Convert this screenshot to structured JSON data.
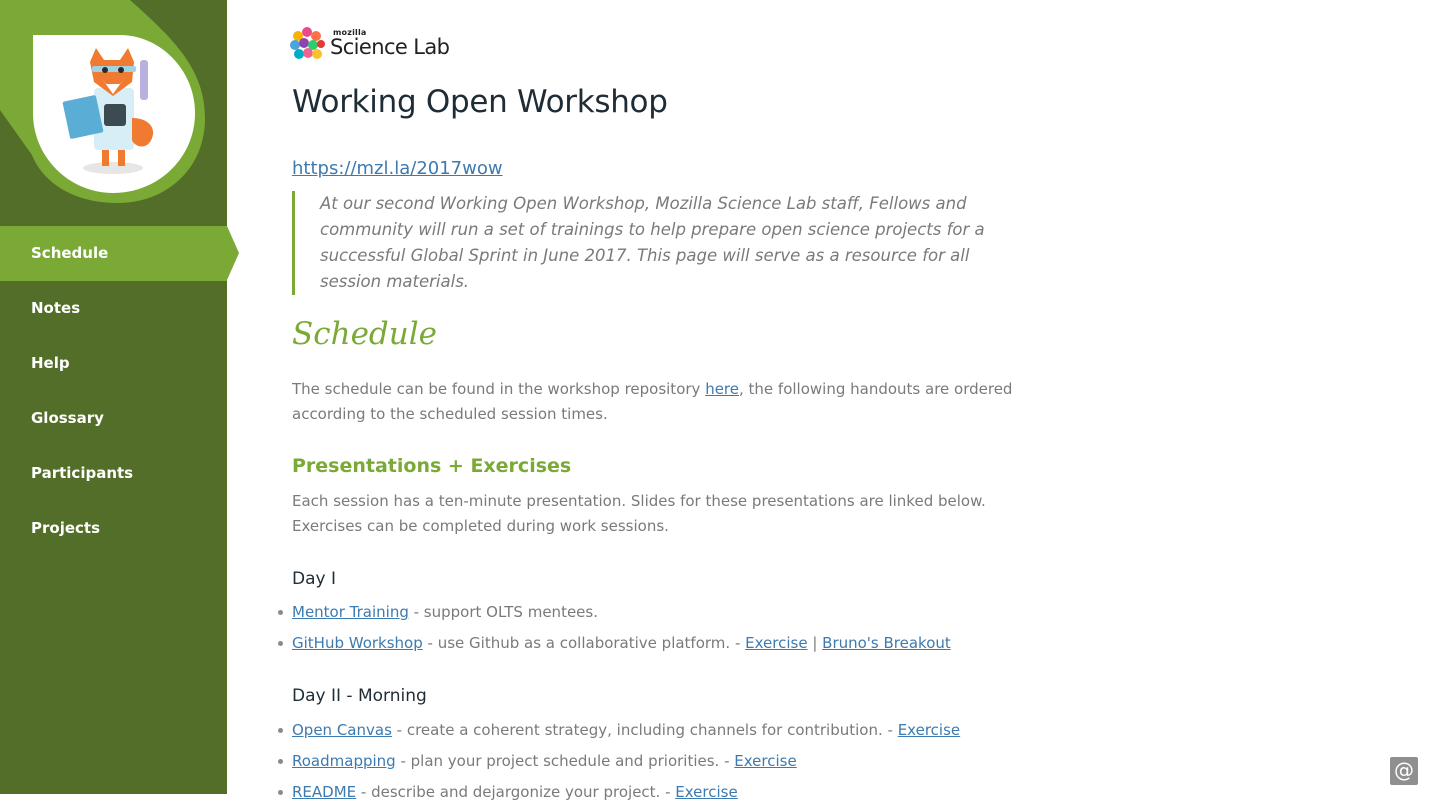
{
  "colors": {
    "sidebar": "#526e28",
    "accent": "#7aaa35",
    "link": "#3d7ab0",
    "heading": "#1f2c36",
    "body_text": "#7a7a7a"
  },
  "logo": {
    "small": "mozilla",
    "big": "Science Lab"
  },
  "nav": {
    "items": [
      {
        "label": "Schedule",
        "active": true
      },
      {
        "label": "Notes"
      },
      {
        "label": "Help"
      },
      {
        "label": "Glossary"
      },
      {
        "label": "Participants"
      },
      {
        "label": "Projects"
      }
    ]
  },
  "page": {
    "title": "Working Open Workshop",
    "short_link": "https://mzl.la/2017wow",
    "intro": "At our second Working Open Workshop, Mozilla Science Lab staff, Fellows and community will run a set of trainings to help prepare open science projects for a successful Global Sprint in June 2017. This page will serve as a resource for all session materials."
  },
  "schedule": {
    "title": "Schedule",
    "text_before": "The schedule can be found in the workshop repository ",
    "link": "here",
    "text_after": ", the following handouts are ordered according to the scheduled session times."
  },
  "presentations": {
    "title": "Presentations + Exercises",
    "text": "Each session has a ten-minute presentation. Slides for these presentations are linked below. Exercises can be completed during work sessions."
  },
  "day1": {
    "title": "Day I",
    "items": [
      {
        "link": "Mentor Training",
        "desc": " - support OLTS mentees."
      },
      {
        "link": "GitHub Workshop",
        "desc": " - use Github as a collaborative platform. - ",
        "exercise": "Exercise",
        "sep": " | ",
        "extra": "Bruno's Breakout"
      }
    ]
  },
  "day2": {
    "title": "Day II - Morning",
    "items": [
      {
        "link": "Open Canvas",
        "desc": " - create a coherent strategy, including channels for contribution. - ",
        "exercise": "Exercise"
      },
      {
        "link": "Roadmapping",
        "desc": " - plan your project schedule and priorities. - ",
        "exercise": "Exercise"
      },
      {
        "link": "README",
        "desc": " - describe and dejargonize your project. - ",
        "exercise": "Exercise"
      }
    ]
  },
  "corner_button": {
    "label": "@"
  }
}
